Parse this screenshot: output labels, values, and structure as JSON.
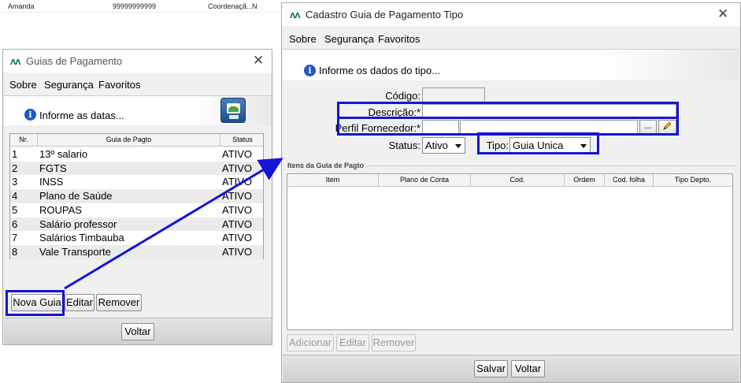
{
  "background_row": {
    "name": "Amanda",
    "phone": "99999999999",
    "role": "Coordenaçã...",
    "flag": "N"
  },
  "win1": {
    "logo": "ʌʌ",
    "title": "Guias de Pagamento",
    "close": "✕",
    "menu": [
      "Sobre",
      "Segurança",
      "Favoritos"
    ],
    "info_text": "Informe as datas...",
    "columns": [
      "Nr.",
      "Guia de Pagto",
      "Status"
    ],
    "rows": [
      {
        "nr": "1",
        "guia": "13º salario",
        "status": "ATIVO"
      },
      {
        "nr": "2",
        "guia": "FGTS",
        "status": "ATIVO"
      },
      {
        "nr": "3",
        "guia": "INSS",
        "status": "ATIVO"
      },
      {
        "nr": "4",
        "guia": "Plano de Saúde",
        "status": "ATIVO"
      },
      {
        "nr": "5",
        "guia": "ROUPAS",
        "status": "ATIVO"
      },
      {
        "nr": "6",
        "guia": "Salário professor",
        "status": "ATIVO"
      },
      {
        "nr": "7",
        "guia": "Salários Timbauba",
        "status": "ATIVO"
      },
      {
        "nr": "8",
        "guia": "Vale Transporte",
        "status": "ATIVO"
      }
    ],
    "buttons": {
      "nova_guia": "Nova Guia",
      "editar": "Editar",
      "remover": "Remover",
      "voltar": "Voltar"
    }
  },
  "win2": {
    "logo": "ʌʌ",
    "title": "Cadastro Guia de Pagamento Tipo",
    "close": "✕",
    "menu": [
      "Sobre",
      "Segurança",
      "Favoritos"
    ],
    "info_text": "Informe os dados do tipo...",
    "form": {
      "codigo_label": "Código:",
      "codigo_value": "",
      "descricao_label": "Descrição:*",
      "descricao_value": "",
      "perfil_label": "Perfil Fornecedor:*",
      "perfil_code": "",
      "perfil_name": "",
      "lookup_button": "...",
      "status_label": "Status:",
      "status_value": "Ativo",
      "tipo_label": "Tipo:",
      "tipo_value": "Guia Unica"
    },
    "items_section_label": "Itens da Guia de Pagto",
    "columns": [
      "Item",
      "Plano de Conta",
      "Cod.",
      "Ordem",
      "Cod. folha",
      "Tipo Depto."
    ],
    "buttons": {
      "adicionar": "Adicionar",
      "editar": "Editar",
      "remover": "Remover",
      "salvar": "Salvar",
      "voltar": "Voltar"
    }
  },
  "colors": {
    "highlight": "#1414d8",
    "info_icon": "#1f56c7",
    "logo": "#0a7a55"
  }
}
